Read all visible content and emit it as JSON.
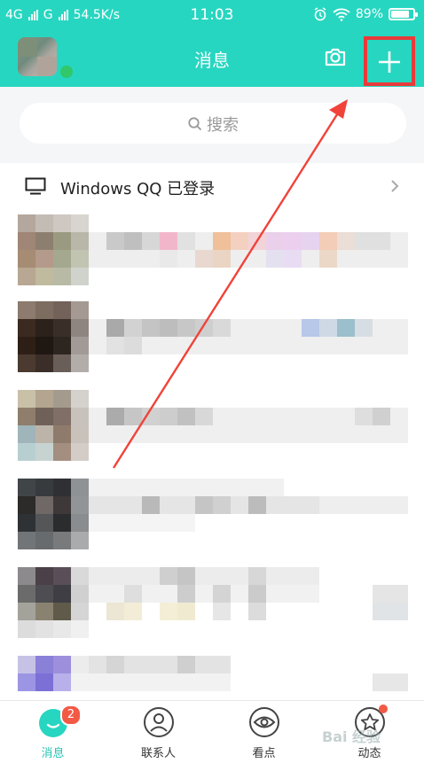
{
  "status_bar": {
    "network1": "4G",
    "network2": "G",
    "speed": "54.5K/s",
    "time": "11:03",
    "battery": "89%"
  },
  "navbar": {
    "title": "消息"
  },
  "search": {
    "placeholder": "搜索"
  },
  "windows_login": {
    "text": "Windows QQ 已登录"
  },
  "tabs": [
    {
      "label": "消息",
      "badge": "2"
    },
    {
      "label": "联系人"
    },
    {
      "label": "看点"
    },
    {
      "label": "动态"
    }
  ],
  "watermark": "Bai 经验",
  "colors": {
    "brand": "#27d6c0",
    "highlight": "#e83a3a",
    "badge": "#f25a45"
  }
}
